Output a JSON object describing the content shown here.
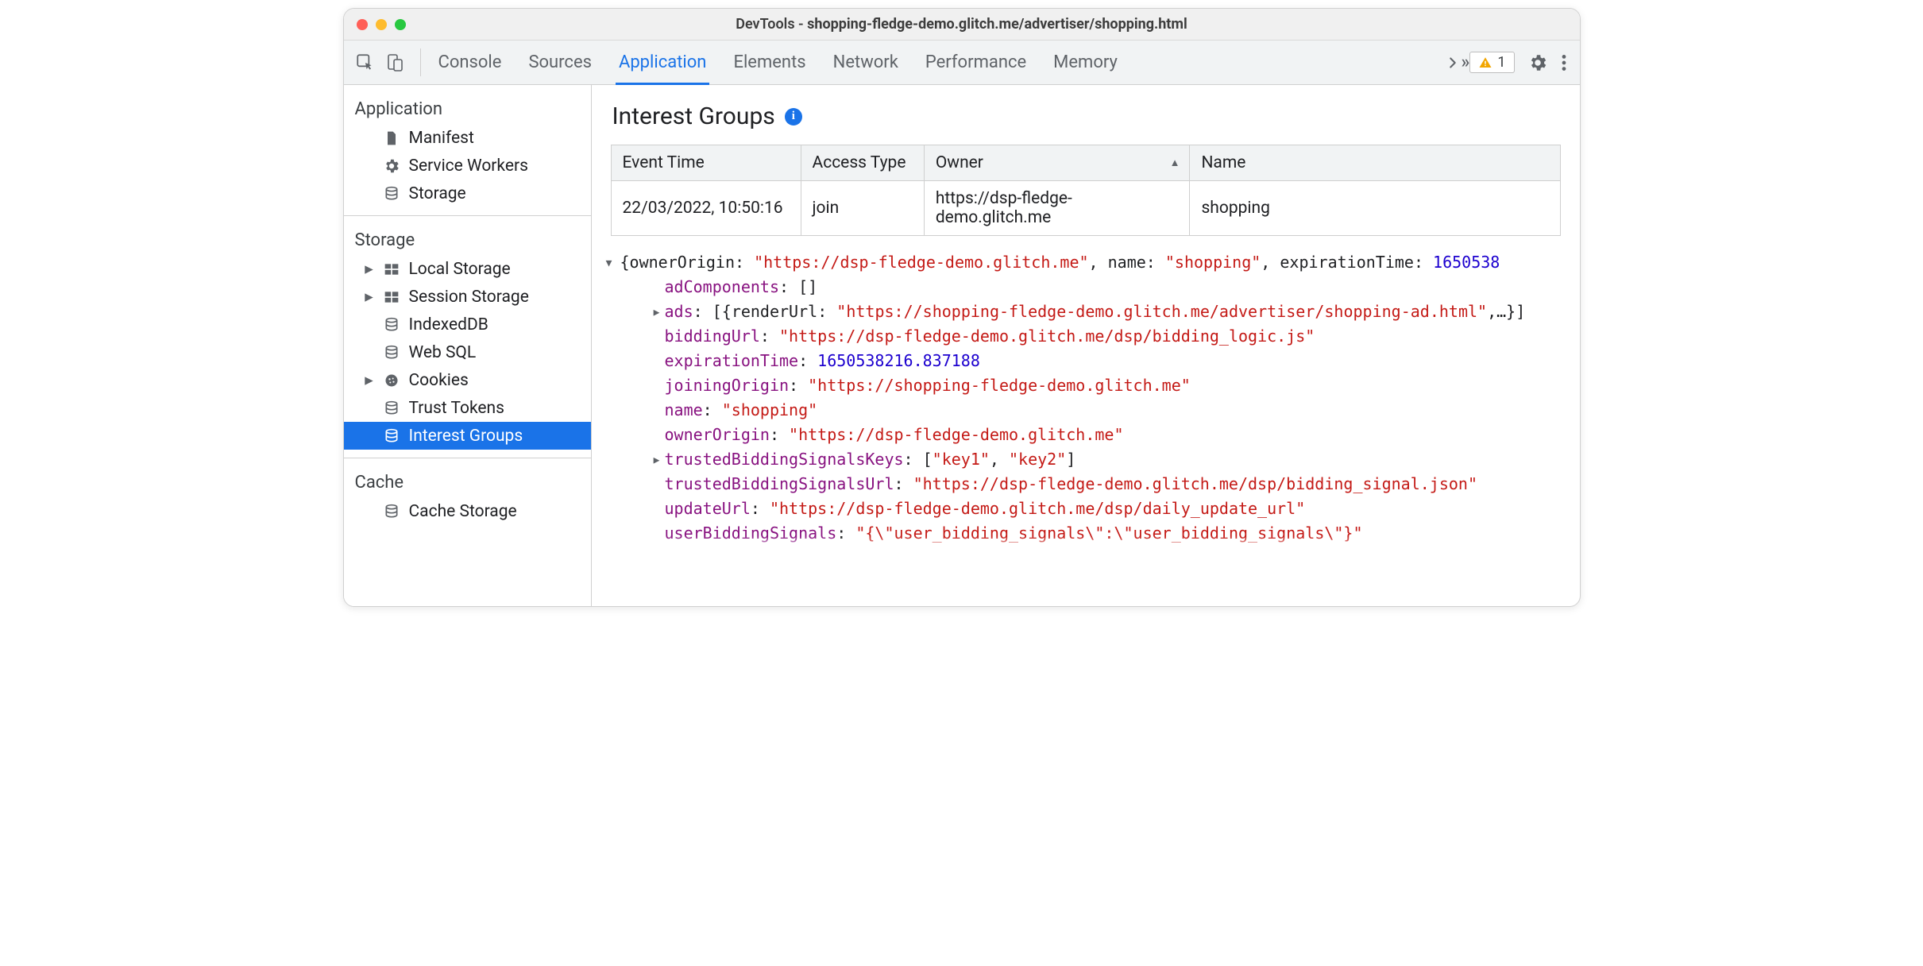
{
  "window": {
    "title_prefix": "DevTools - ",
    "title_url": "shopping-fledge-demo.glitch.me/advertiser/shopping.html"
  },
  "toolbar": {
    "tabs": [
      "Console",
      "Sources",
      "Application",
      "Elements",
      "Network",
      "Performance",
      "Memory"
    ],
    "active_tab_index": 2,
    "warning_count": "1"
  },
  "sidebar": {
    "sections": [
      {
        "title": "Application",
        "items": [
          {
            "label": "Manifest",
            "icon": "file",
            "caret": false
          },
          {
            "label": "Service Workers",
            "icon": "gear",
            "caret": false
          },
          {
            "label": "Storage",
            "icon": "db",
            "caret": false
          }
        ]
      },
      {
        "title": "Storage",
        "items": [
          {
            "label": "Local Storage",
            "icon": "grid",
            "caret": true
          },
          {
            "label": "Session Storage",
            "icon": "grid",
            "caret": true
          },
          {
            "label": "IndexedDB",
            "icon": "db",
            "caret": false
          },
          {
            "label": "Web SQL",
            "icon": "db",
            "caret": false
          },
          {
            "label": "Cookies",
            "icon": "cookie",
            "caret": true
          },
          {
            "label": "Trust Tokens",
            "icon": "db",
            "caret": false
          },
          {
            "label": "Interest Groups",
            "icon": "db",
            "caret": false,
            "selected": true
          }
        ]
      },
      {
        "title": "Cache",
        "items": [
          {
            "label": "Cache Storage",
            "icon": "db",
            "caret": false
          }
        ]
      }
    ]
  },
  "main": {
    "heading": "Interest Groups",
    "table": {
      "headers": [
        "Event Time",
        "Access Type",
        "Owner",
        "Name"
      ],
      "sort_col": 2,
      "rows": [
        [
          "22/03/2022, 10:50:16",
          "join",
          "https://dsp-fledge-demo.glitch.me",
          "shopping"
        ]
      ]
    },
    "tree": {
      "summary_keys": [
        "ownerOrigin",
        "name",
        "expirationTime"
      ],
      "summary_vals": [
        "\"https://dsp-fledge-demo.glitch.me\"",
        "\"shopping\"",
        "1650538"
      ],
      "lines": [
        {
          "indent": 1,
          "caret": "",
          "key": "adComponents",
          "val": "[]",
          "type": "p"
        },
        {
          "indent": 1,
          "caret": "▸",
          "key": "ads",
          "raw": "[{renderUrl: \"https://shopping-fledge-demo.glitch.me/advertiser/shopping-ad.html\",…}]"
        },
        {
          "indent": 1,
          "caret": "",
          "key": "biddingUrl",
          "val": "\"https://dsp-fledge-demo.glitch.me/dsp/bidding_logic.js\"",
          "type": "s"
        },
        {
          "indent": 1,
          "caret": "",
          "key": "expirationTime",
          "val": "1650538216.837188",
          "type": "n"
        },
        {
          "indent": 1,
          "caret": "",
          "key": "joiningOrigin",
          "val": "\"https://shopping-fledge-demo.glitch.me\"",
          "type": "s"
        },
        {
          "indent": 1,
          "caret": "",
          "key": "name",
          "val": "\"shopping\"",
          "type": "s"
        },
        {
          "indent": 1,
          "caret": "",
          "key": "ownerOrigin",
          "val": "\"https://dsp-fledge-demo.glitch.me\"",
          "type": "s"
        },
        {
          "indent": 1,
          "caret": "▸",
          "key": "trustedBiddingSignalsKeys",
          "raw": "[\"key1\", \"key2\"]"
        },
        {
          "indent": 1,
          "caret": "",
          "key": "trustedBiddingSignalsUrl",
          "val": "\"https://dsp-fledge-demo.glitch.me/dsp/bidding_signal.json\"",
          "type": "s"
        },
        {
          "indent": 1,
          "caret": "",
          "key": "updateUrl",
          "val": "\"https://dsp-fledge-demo.glitch.me/dsp/daily_update_url\"",
          "type": "s"
        },
        {
          "indent": 1,
          "caret": "",
          "key": "userBiddingSignals",
          "val": "\"{\\\"user_bidding_signals\\\":\\\"user_bidding_signals\\\"}\"",
          "type": "s"
        }
      ]
    }
  }
}
